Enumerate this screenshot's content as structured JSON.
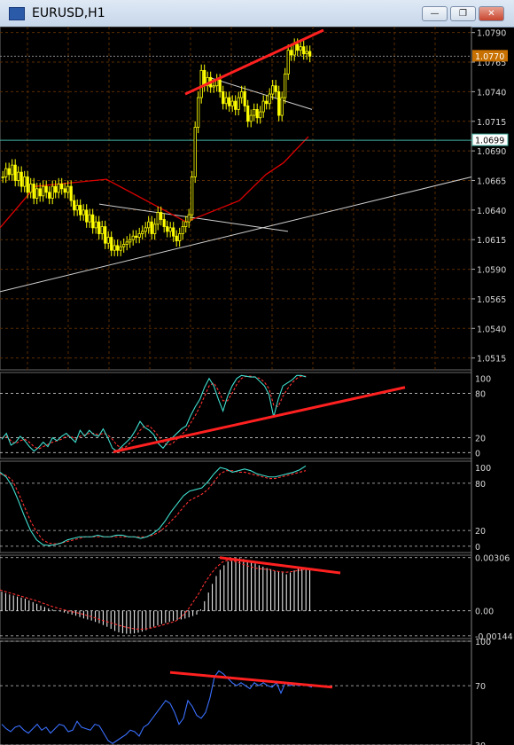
{
  "window": {
    "title": "EURUSD,H1",
    "buttons": [
      "minimize",
      "restore",
      "close"
    ]
  },
  "colors": {
    "bull": "#ffff00",
    "bear": "#ffff00",
    "ma_red": "#dd0000",
    "trendline": "#d0d0d0",
    "divergence": "#ff2020",
    "grid": "#5a2c00",
    "price_tag": "#c87000",
    "hline_tag": "#40b0a0",
    "stoch_main": "#40e0d0",
    "stoch_signal": "#ff3030",
    "rsi": "#3a70ff",
    "histogram": "#ffffff"
  },
  "price_panel": {
    "symbol": "EURUSD",
    "timeframe": "H1",
    "price_ticks": [
      "1.0790",
      "1.0765",
      "1.0740",
      "1.0715",
      "1.0690",
      "1.0665",
      "1.0640",
      "1.0615",
      "1.0590",
      "1.0565",
      "1.0540",
      "1.0515"
    ],
    "current_price": "1.0770",
    "horizontal_line": "1.0699"
  },
  "stoch1_panel": {
    "ticks": [
      "100",
      "80",
      "20",
      "0"
    ]
  },
  "stoch2_panel": {
    "ticks": [
      "100",
      "80",
      "20",
      "0"
    ]
  },
  "macd_panel": {
    "ticks": [
      "0.00306",
      "0.00",
      "-0.00144"
    ]
  },
  "rsi_panel": {
    "ticks": [
      "100",
      "70",
      "30"
    ]
  },
  "chart_data": [
    {
      "type": "candlestick",
      "name": "EURUSD,H1",
      "ylim": [
        1.0505,
        1.0795
      ],
      "price_ticks": [
        1.079,
        1.0765,
        1.074,
        1.0715,
        1.069,
        1.0665,
        1.064,
        1.0615,
        1.059,
        1.0565,
        1.054,
        1.0515
      ],
      "current_price": 1.077,
      "horizontal_line": 1.0699,
      "closes": [
        1.0668,
        1.0675,
        1.067,
        1.0678,
        1.0665,
        1.0672,
        1.066,
        1.0668,
        1.0655,
        1.0662,
        1.065,
        1.0658,
        1.0652,
        1.066,
        1.0655,
        1.065,
        1.066,
        1.0655,
        1.0662,
        1.0658,
        1.0655,
        1.066,
        1.0648,
        1.064,
        1.0644,
        1.0636,
        1.064,
        1.063,
        1.0636,
        1.0625,
        1.063,
        1.062,
        1.0626,
        1.0612,
        1.0617,
        1.0606,
        1.061,
        1.0606,
        1.0609,
        1.0611,
        1.0613,
        1.0615,
        1.0618,
        1.0617,
        1.062,
        1.0622,
        1.0625,
        1.063,
        1.062,
        1.0628,
        1.0638,
        1.0632,
        1.0626,
        1.0622,
        1.0625,
        1.0618,
        1.0614,
        1.062,
        1.0626,
        1.063,
        1.0636,
        1.0668,
        1.071,
        1.0735,
        1.0758,
        1.0745,
        1.0752,
        1.0744,
        1.0745,
        1.075,
        1.074,
        1.073,
        1.0735,
        1.0728,
        1.0732,
        1.0725,
        1.0735,
        1.074,
        1.0728,
        1.0715,
        1.072,
        1.0725,
        1.0718,
        1.0723,
        1.0732,
        1.073,
        1.0738,
        1.0745,
        1.074,
        1.072,
        1.0735,
        1.0755,
        1.0775,
        1.0771,
        1.078,
        1.0775,
        1.0778,
        1.0772,
        1.0774,
        1.077
      ],
      "moving_average_red": [
        [
          0,
          1.0625
        ],
        [
          40,
          1.066
        ],
        [
          120,
          1.0666
        ],
        [
          210,
          1.063
        ],
        [
          270,
          1.0648
        ],
        [
          300,
          1.067
        ],
        [
          320,
          1.068
        ],
        [
          348,
          1.0702
        ]
      ],
      "trendlines": [
        {
          "points": [
            [
              0,
              1.0571
            ],
            [
              532,
              1.0668
            ]
          ]
        },
        {
          "points": [
            [
              112,
              1.0645
            ],
            [
              325,
              1.0622
            ]
          ]
        },
        {
          "points": [
            [
              236,
              1.0752
            ],
            [
              352,
              1.0725
            ]
          ]
        }
      ],
      "divergence_line": [
        [
          209,
          1.0738
        ],
        [
          365,
          1.0792
        ]
      ]
    },
    {
      "type": "line",
      "name": "stochastic-1",
      "ylim": [
        -8,
        108
      ],
      "levels": [
        100,
        80,
        20,
        0
      ],
      "series": [
        {
          "values": [
            18,
            26,
            10,
            14,
            22,
            16,
            8,
            2,
            7,
            14,
            8,
            20,
            16,
            22,
            26,
            20,
            14,
            30,
            22,
            30,
            24,
            22,
            32,
            20,
            6,
            2,
            8,
            14,
            20,
            30,
            42,
            34,
            30,
            24,
            12,
            6,
            14,
            20,
            26,
            32,
            36,
            50,
            62,
            72,
            88,
            100,
            90,
            72,
            56,
            76,
            90,
            100,
            104,
            103,
            102,
            102,
            96,
            90,
            78,
            48,
            72,
            90,
            94,
            98,
            104,
            104,
            102
          ]
        },
        {
          "values": [
            20,
            22,
            16,
            12,
            16,
            18,
            14,
            8,
            5,
            8,
            11,
            14,
            16,
            18,
            22,
            22,
            18,
            22,
            24,
            26,
            26,
            24,
            26,
            24,
            18,
            10,
            6,
            8,
            14,
            20,
            30,
            36,
            36,
            30,
            22,
            14,
            10,
            12,
            18,
            24,
            30,
            40,
            50,
            62,
            76,
            90,
            94,
            84,
            70,
            70,
            80,
            92,
            100,
            103,
            103,
            102,
            100,
            95,
            86,
            64,
            62,
            76,
            86,
            94,
            100,
            103,
            103
          ]
        }
      ],
      "divergence_line": [
        [
          128,
          1
        ],
        [
          457,
          88
        ]
      ]
    },
    {
      "type": "line",
      "name": "stochastic-2",
      "ylim": [
        -8,
        108
      ],
      "levels": [
        100,
        80,
        20,
        0
      ],
      "series": [
        {
          "values": [
            94,
            88,
            76,
            58,
            38,
            20,
            8,
            2,
            1,
            2,
            4,
            8,
            10,
            12,
            12,
            12,
            14,
            12,
            12,
            14,
            14,
            12,
            12,
            10,
            12,
            16,
            22,
            32,
            44,
            54,
            64,
            70,
            72,
            74,
            82,
            92,
            100,
            98,
            94,
            96,
            98,
            96,
            92,
            90,
            88,
            88,
            90,
            92,
            94,
            97,
            102
          ]
        },
        {
          "values": [
            92,
            90,
            84,
            68,
            50,
            32,
            18,
            8,
            4,
            3,
            4,
            6,
            8,
            10,
            12,
            12,
            12,
            12,
            12,
            12,
            12,
            12,
            12,
            12,
            12,
            14,
            18,
            24,
            32,
            40,
            50,
            58,
            62,
            66,
            72,
            82,
            92,
            96,
            96,
            94,
            94,
            92,
            90,
            88,
            86,
            86,
            88,
            90,
            92,
            94,
            96
          ]
        }
      ]
    },
    {
      "type": "bar",
      "name": "macd",
      "ylim": [
        -0.0016,
        0.0032
      ],
      "levels": [
        0.00306,
        0.0,
        -0.00144
      ],
      "histogram": [
        0.0011,
        0.00102,
        0.00094,
        0.00088,
        0.00082,
        0.00076,
        0.0007,
        0.0006,
        0.0005,
        0.0004,
        0.0003,
        0.00022,
        0.00014,
        8e-05,
        2e-05,
        -4e-05,
        -0.0001,
        -0.00016,
        -0.00022,
        -0.00028,
        -0.00036,
        -0.00044,
        -0.0005,
        -0.00056,
        -0.00064,
        -0.00072,
        -0.00082,
        -0.00092,
        -0.00104,
        -0.00116,
        -0.00124,
        -0.0013,
        -0.00132,
        -0.00132,
        -0.0013,
        -0.00126,
        -0.0012,
        -0.00112,
        -0.001,
        -0.00092,
        -0.00084,
        -0.00076,
        -0.0007,
        -0.00064,
        -0.00058,
        -0.00054,
        -0.0005,
        -0.00045,
        -0.00038,
        -0.0003,
        -0.00022,
        8e-05,
        0.00055,
        0.00105,
        0.00155,
        0.002,
        0.00236,
        0.00262,
        0.00284,
        0.00296,
        0.00304,
        0.00302,
        0.00298,
        0.00292,
        0.00282,
        0.00272,
        0.00262,
        0.00254,
        0.00246,
        0.0024,
        0.00232,
        0.00226,
        0.0022,
        0.0021,
        0.0022,
        0.00232,
        0.00244,
        0.00246,
        0.00244,
        0.00242
      ],
      "signal": [
        0.0012,
        0.0011,
        0.001,
        0.0009,
        0.0008,
        0.0007,
        0.0006,
        0.00048,
        0.00036,
        0.00024,
        0.00014,
        5e-05,
        -3e-05,
        -0.0001,
        -0.00018,
        -0.00028,
        -0.00038,
        -0.0005,
        -0.0006,
        -0.0007,
        -0.0008,
        -0.0009,
        -0.00098,
        -0.00104,
        -0.00106,
        -0.00104,
        -0.00098,
        -0.0009,
        -0.0008,
        -0.0007,
        -0.0006,
        -0.00035,
        0.0,
        0.0005,
        0.001,
        0.0016,
        0.0021,
        0.0025,
        0.0028,
        0.00292,
        0.00286,
        0.00274,
        0.00262,
        0.00252,
        0.00244,
        0.0024,
        0.00238,
        0.0023,
        0.00224,
        0.00222,
        0.00226,
        0.00232,
        0.00236
      ],
      "divergence_line": [
        [
          248,
          0.00306
        ],
        [
          384,
          0.00218
        ]
      ]
    },
    {
      "type": "line",
      "name": "rsi",
      "ylim": [
        30,
        100
      ],
      "levels": [
        100,
        70,
        30
      ],
      "series": [
        {
          "values": [
            44,
            41,
            39,
            42,
            43,
            40,
            38,
            41,
            44,
            40,
            42,
            38,
            41,
            44,
            43,
            39,
            40,
            46,
            42,
            41,
            40,
            44,
            43,
            38,
            33,
            31,
            33,
            35,
            37,
            40,
            39,
            36,
            42,
            44,
            48,
            52,
            56,
            60,
            58,
            52,
            44,
            48,
            60,
            56,
            50,
            48,
            52,
            62,
            76,
            80,
            78,
            75,
            72,
            70,
            72,
            70,
            68,
            72,
            70,
            72,
            70,
            69,
            72,
            65,
            72,
            70,
            71,
            70,
            71,
            70,
            69
          ]
        }
      ],
      "divergence_line": [
        [
          192,
          79
        ],
        [
          375,
          69
        ]
      ]
    }
  ]
}
